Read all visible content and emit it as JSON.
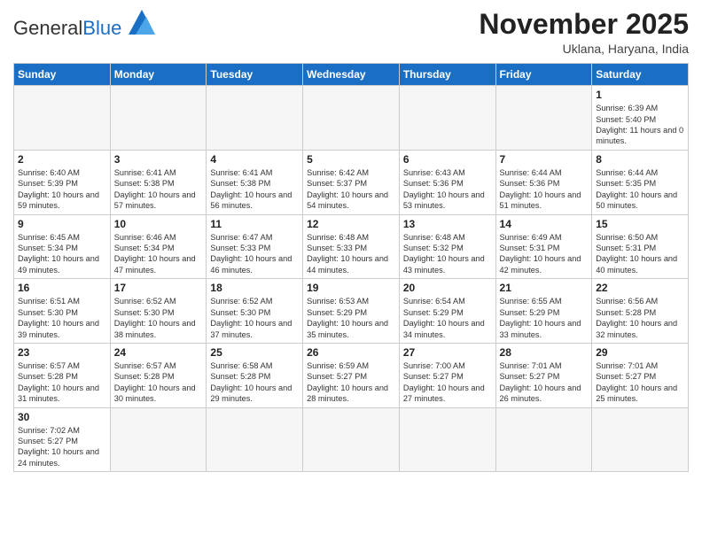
{
  "header": {
    "logo_general": "General",
    "logo_blue": "Blue",
    "month_title": "November 2025",
    "location": "Uklana, Haryana, India"
  },
  "days_of_week": [
    "Sunday",
    "Monday",
    "Tuesday",
    "Wednesday",
    "Thursday",
    "Friday",
    "Saturday"
  ],
  "weeks": [
    [
      {
        "day": "",
        "info": ""
      },
      {
        "day": "",
        "info": ""
      },
      {
        "day": "",
        "info": ""
      },
      {
        "day": "",
        "info": ""
      },
      {
        "day": "",
        "info": ""
      },
      {
        "day": "",
        "info": ""
      },
      {
        "day": "1",
        "info": "Sunrise: 6:39 AM\nSunset: 5:40 PM\nDaylight: 11 hours\nand 0 minutes."
      }
    ],
    [
      {
        "day": "2",
        "info": "Sunrise: 6:40 AM\nSunset: 5:39 PM\nDaylight: 10 hours\nand 59 minutes."
      },
      {
        "day": "3",
        "info": "Sunrise: 6:41 AM\nSunset: 5:38 PM\nDaylight: 10 hours\nand 57 minutes."
      },
      {
        "day": "4",
        "info": "Sunrise: 6:41 AM\nSunset: 5:38 PM\nDaylight: 10 hours\nand 56 minutes."
      },
      {
        "day": "5",
        "info": "Sunrise: 6:42 AM\nSunset: 5:37 PM\nDaylight: 10 hours\nand 54 minutes."
      },
      {
        "day": "6",
        "info": "Sunrise: 6:43 AM\nSunset: 5:36 PM\nDaylight: 10 hours\nand 53 minutes."
      },
      {
        "day": "7",
        "info": "Sunrise: 6:44 AM\nSunset: 5:36 PM\nDaylight: 10 hours\nand 51 minutes."
      },
      {
        "day": "8",
        "info": "Sunrise: 6:44 AM\nSunset: 5:35 PM\nDaylight: 10 hours\nand 50 minutes."
      }
    ],
    [
      {
        "day": "9",
        "info": "Sunrise: 6:45 AM\nSunset: 5:34 PM\nDaylight: 10 hours\nand 49 minutes."
      },
      {
        "day": "10",
        "info": "Sunrise: 6:46 AM\nSunset: 5:34 PM\nDaylight: 10 hours\nand 47 minutes."
      },
      {
        "day": "11",
        "info": "Sunrise: 6:47 AM\nSunset: 5:33 PM\nDaylight: 10 hours\nand 46 minutes."
      },
      {
        "day": "12",
        "info": "Sunrise: 6:48 AM\nSunset: 5:33 PM\nDaylight: 10 hours\nand 44 minutes."
      },
      {
        "day": "13",
        "info": "Sunrise: 6:48 AM\nSunset: 5:32 PM\nDaylight: 10 hours\nand 43 minutes."
      },
      {
        "day": "14",
        "info": "Sunrise: 6:49 AM\nSunset: 5:31 PM\nDaylight: 10 hours\nand 42 minutes."
      },
      {
        "day": "15",
        "info": "Sunrise: 6:50 AM\nSunset: 5:31 PM\nDaylight: 10 hours\nand 40 minutes."
      }
    ],
    [
      {
        "day": "16",
        "info": "Sunrise: 6:51 AM\nSunset: 5:30 PM\nDaylight: 10 hours\nand 39 minutes."
      },
      {
        "day": "17",
        "info": "Sunrise: 6:52 AM\nSunset: 5:30 PM\nDaylight: 10 hours\nand 38 minutes."
      },
      {
        "day": "18",
        "info": "Sunrise: 6:52 AM\nSunset: 5:30 PM\nDaylight: 10 hours\nand 37 minutes."
      },
      {
        "day": "19",
        "info": "Sunrise: 6:53 AM\nSunset: 5:29 PM\nDaylight: 10 hours\nand 35 minutes."
      },
      {
        "day": "20",
        "info": "Sunrise: 6:54 AM\nSunset: 5:29 PM\nDaylight: 10 hours\nand 34 minutes."
      },
      {
        "day": "21",
        "info": "Sunrise: 6:55 AM\nSunset: 5:29 PM\nDaylight: 10 hours\nand 33 minutes."
      },
      {
        "day": "22",
        "info": "Sunrise: 6:56 AM\nSunset: 5:28 PM\nDaylight: 10 hours\nand 32 minutes."
      }
    ],
    [
      {
        "day": "23",
        "info": "Sunrise: 6:57 AM\nSunset: 5:28 PM\nDaylight: 10 hours\nand 31 minutes."
      },
      {
        "day": "24",
        "info": "Sunrise: 6:57 AM\nSunset: 5:28 PM\nDaylight: 10 hours\nand 30 minutes."
      },
      {
        "day": "25",
        "info": "Sunrise: 6:58 AM\nSunset: 5:28 PM\nDaylight: 10 hours\nand 29 minutes."
      },
      {
        "day": "26",
        "info": "Sunrise: 6:59 AM\nSunset: 5:27 PM\nDaylight: 10 hours\nand 28 minutes."
      },
      {
        "day": "27",
        "info": "Sunrise: 7:00 AM\nSunset: 5:27 PM\nDaylight: 10 hours\nand 27 minutes."
      },
      {
        "day": "28",
        "info": "Sunrise: 7:01 AM\nSunset: 5:27 PM\nDaylight: 10 hours\nand 26 minutes."
      },
      {
        "day": "29",
        "info": "Sunrise: 7:01 AM\nSunset: 5:27 PM\nDaylight: 10 hours\nand 25 minutes."
      }
    ],
    [
      {
        "day": "30",
        "info": "Sunrise: 7:02 AM\nSunset: 5:27 PM\nDaylight: 10 hours\nand 24 minutes."
      },
      {
        "day": "",
        "info": ""
      },
      {
        "day": "",
        "info": ""
      },
      {
        "day": "",
        "info": ""
      },
      {
        "day": "",
        "info": ""
      },
      {
        "day": "",
        "info": ""
      },
      {
        "day": "",
        "info": ""
      }
    ]
  ]
}
